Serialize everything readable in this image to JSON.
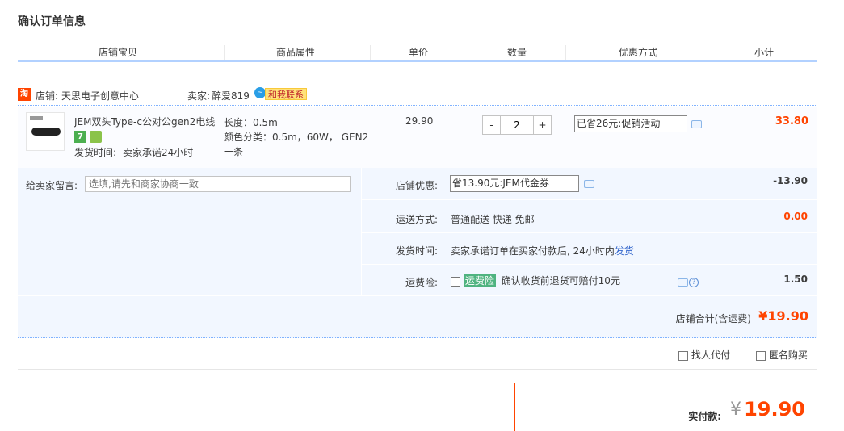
{
  "page_title": "确认订单信息",
  "columns": [
    "店铺宝贝",
    "商品属性",
    "单价",
    "数量",
    "优惠方式",
    "小计"
  ],
  "shop": {
    "icon_text": "淘",
    "name_label": "店铺:",
    "name": "天思电子创意中心",
    "seller_label": "卖家:",
    "seller_name": "醉爱819",
    "contact_label": "和我联系"
  },
  "item": {
    "title": "JEM双头Type-c公对公gen2电线",
    "badge_seven": "7",
    "ship_label": "发货时间:",
    "ship_value": "卖家承诺24小时",
    "attr_length": "长度：0.5m",
    "attr_color_1": "颜色分类：0.5m，60W， GEN2",
    "attr_color_2": "一条",
    "unit_price": "29.90",
    "qty_minus": "-",
    "qty_value": "2",
    "qty_plus": "+",
    "promo": "已省26元:促销活动",
    "subtotal": "33.80"
  },
  "message": {
    "label": "给卖家留言:",
    "placeholder": "选填,请先和商家协商一致"
  },
  "shop_discount": {
    "label": "店铺优惠:",
    "value": "省13.90元:JEM代金券",
    "amount": "-13.90"
  },
  "shipping": {
    "label": "运送方式:",
    "value": "普通配送 快递 免邮",
    "amount": "0.00"
  },
  "delivery": {
    "label": "发货时间:",
    "value": "卖家承诺订单在买家付款后, 24小时内",
    "link": "发货"
  },
  "insurance": {
    "label": "运费险:",
    "tag": "运费险",
    "desc": "确认收货前退货可赔付10元",
    "amount": "1.50",
    "help": "?"
  },
  "shop_total": {
    "label": "店铺合计(含运费)",
    "value": "¥19.90"
  },
  "options": {
    "pay_for_me": "找人代付",
    "anonymous": "匿名购买"
  },
  "payment": {
    "label": "实付款:",
    "currency": "¥",
    "value": "19.90"
  },
  "colors": {
    "accent": "#ff4400",
    "header_line": "#b2d1ff",
    "panel": "#f2f7ff",
    "link": "#3366cc"
  }
}
